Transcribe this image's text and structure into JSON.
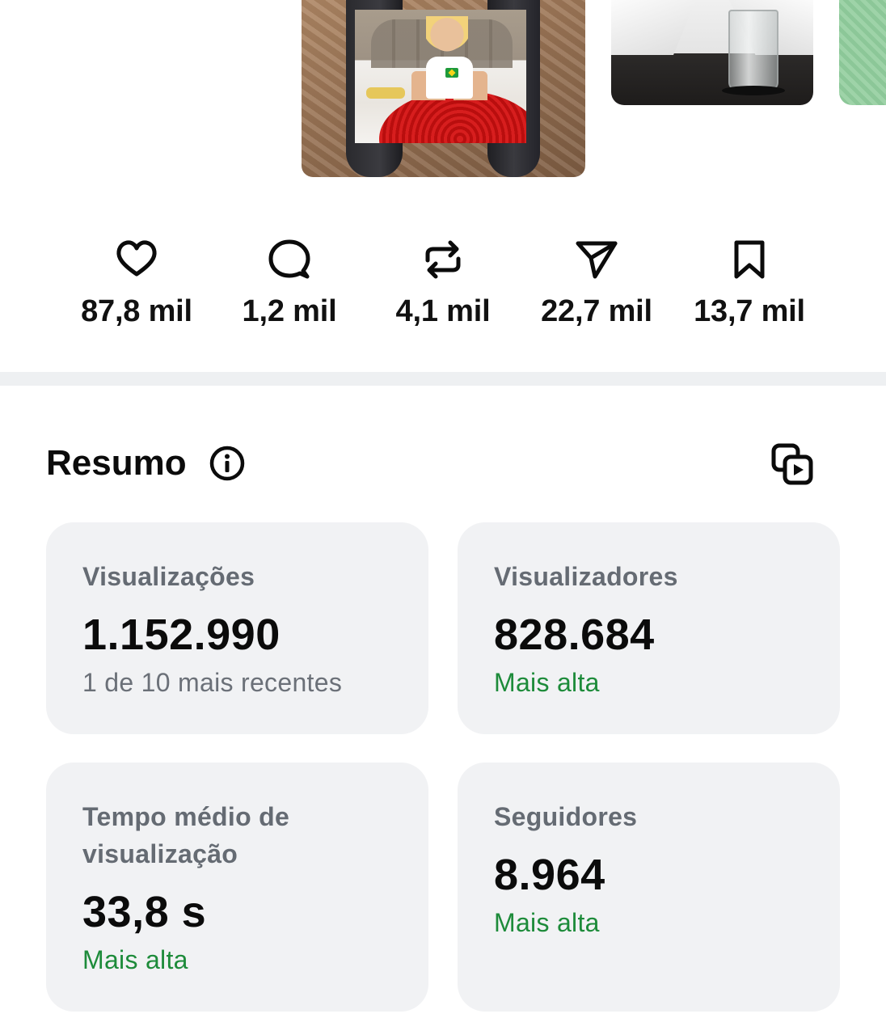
{
  "thumbnails": [
    {
      "name": "post-thumbnail-selected"
    },
    {
      "name": "post-thumbnail-2"
    },
    {
      "name": "post-thumbnail-3"
    }
  ],
  "engagement": {
    "likes": {
      "icon": "heart-icon",
      "value": "87,8 mil"
    },
    "comments": {
      "icon": "comment-icon",
      "value": "1,2 mil"
    },
    "reposts": {
      "icon": "repost-icon",
      "value": "4,1 mil"
    },
    "shares": {
      "icon": "send-icon",
      "value": "22,7 mil"
    },
    "saves": {
      "icon": "bookmark-icon",
      "value": "13,7 mil"
    }
  },
  "summary": {
    "title": "Resumo",
    "info_icon": "info-icon",
    "action_icon": "copy-media-icon",
    "cards": {
      "views": {
        "label": "Visualizações",
        "value": "1.152.990",
        "note": "1 de 10 mais recentes"
      },
      "viewers": {
        "label": "Visualizadores",
        "value": "828.684",
        "note": "Mais alta"
      },
      "watch_time": {
        "label_line1": "Tempo médio de",
        "label_line2": "visualização",
        "value": "33,8 s",
        "note": "Mais alta"
      },
      "followers": {
        "label": "Seguidores",
        "value": "8.964",
        "note": "Mais alta"
      }
    }
  },
  "colors": {
    "card_background": "#f1f2f4",
    "positive_green": "#1d8b3a",
    "label_gray": "#656b73",
    "divider": "#eef0f2"
  }
}
